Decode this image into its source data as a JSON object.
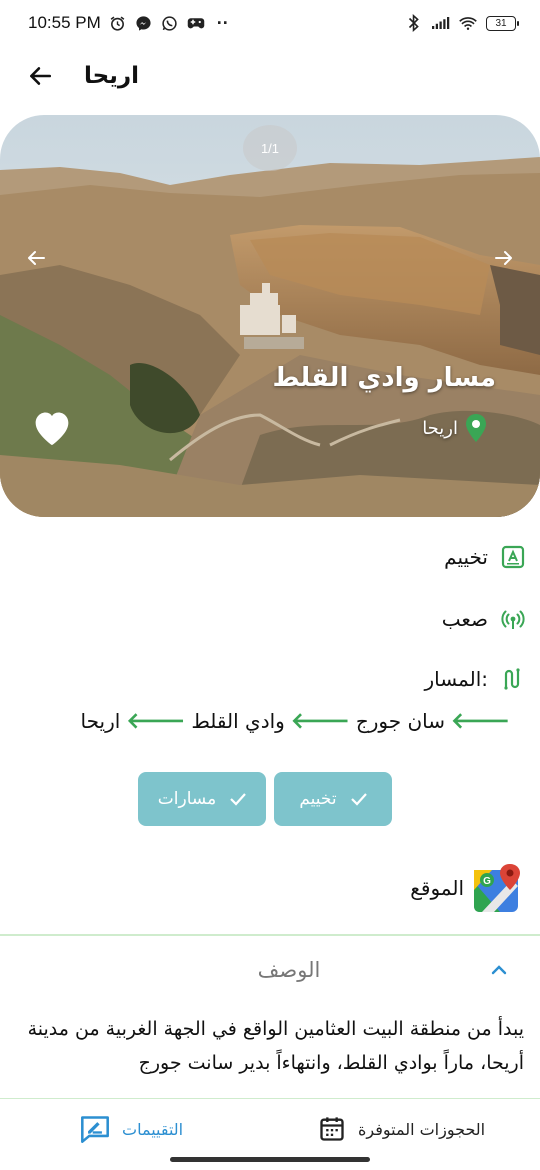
{
  "status_bar": {
    "time": "10:55 PM",
    "battery": "31",
    "dots": "··"
  },
  "header": {
    "title": "اريحا"
  },
  "hero": {
    "counter": "1/1",
    "place_name": "مسار وادي القلط",
    "city": "اريحا"
  },
  "info": {
    "activity": "تخييم",
    "difficulty": "صعب",
    "route_label": "المسار:",
    "route_stops": [
      "سان جورج",
      "وادي  القلط",
      "اريحا"
    ]
  },
  "tags": [
    {
      "label": "تخييم"
    },
    {
      "label": "مسارات"
    }
  ],
  "location": {
    "label": "الموقع"
  },
  "description": {
    "title": "الوصف",
    "body": "يبدأ من منطقة البيت العثامين الواقع في الجهة الغربية من مدينة أريحا، ماراً بوادي القلط، وانتهاءاً بدير سانت جورج"
  },
  "bottom_nav": {
    "bookings": "الحجوزات المتوفرة",
    "ratings": "التقييمات"
  },
  "colors": {
    "accent_green": "#3aa655",
    "tag_bg": "#7ec4cc",
    "ratings_blue": "#2c8fd1"
  }
}
